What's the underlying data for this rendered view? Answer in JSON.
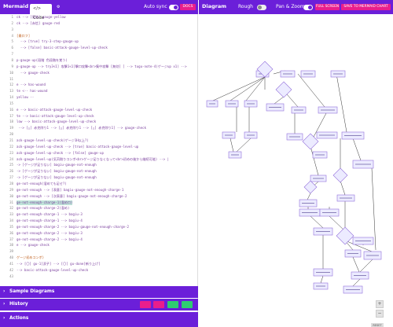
{
  "editor": {
    "title": "Mermaid",
    "tabs": [
      {
        "label": "Code",
        "icon": "code-icon"
      },
      {
        "label": "Config",
        "icon": "gear-icon"
      }
    ],
    "auto_sync_label": "Auto sync",
    "docs_label": "DOCS",
    "lines": [
      "ck --> [見地] gauge-yellow",
      "ck --> [赤信] gauge-red",
      "",
      "[最口フ]",
      "  --> [true] try-3-step-gauge-up",
      "  --> [false] basic-attack-gauge-level-up-check",
      "",
      "p-gauge-up(段階 色段階を覚う)",
      "p-gauge-up --> try3<1] 攻撃1<1]撃口攻撃<br>集中攻撃 [無効] ] --> tugu-note-4(ゲージup x1) -->",
      "  --> gauge-check",
      "",
      "e --> has-wound",
      "te <-- has-wound",
      "yellow -- ",
      "",
      "e --> basic-attack-gauge-level-up-check",
      "te --> basic-attack-gauge-level-up-check",
      "low --> basic-attack-gauge-level-up-check",
      " --> [△] 赤克除り1 --> [△] 赤克除り1 --> [△] 赤克除り1] --> gauge-check",
      "",
      "ack-gauge-level-up-check(ゲージ1H以上?)",
      "ack-gauge-level-up-check --> [true] basic-attack-gauge-level-up",
      "ack-gauge-level-up-check --> [false] gauge-up",
      "ack-gauge-level-up(気苅剛りコンボ<br>ゲージ足りなくなって<br>初めの後から継続可能) --> |",
      "-> [ゲージが足りない] bagiu-gauge-not-enough",
      "-> [ゲージが足りない] bagiu-gauge-not-enough",
      "-> [ゲージが足りない] bagiu-gauge-not-enough",
      "ge-not-enough(溜めても足せ?)",
      "ge-not-enough --> [表意] bagiu-gauge-not-enough-charge-1",
      "ge-not-enough --> [次表意] bagiu-gauge-not-enough-charge-2",
      "ge-not-enough-charge-1(溜め口)",
      "ge-not-enough-charge-2(溜め)",
      "ge-not-enough-charge-1 --> bagiu-3",
      "ge-not-enough-charge-1 --> bagiu-4",
      "ge-not-enough-charge-2 --> bagiu-gauge-not-enough-charge-2",
      "ge-not-enough-charge-2 --> bagiu-3",
      "ge-not-enough-charge-2 --> bagiu-4",
      "e --> gauge-check",
      "",
      "ゲージ初めコンボ)",
      "--> [〇] gu-1[涙子] --> [〇] gu-done[斬り上げ]",
      "--> basic-attack-gauge-level-up-check",
      ""
    ],
    "line_numbers": [
      1,
      2,
      3,
      4,
      5,
      6,
      7,
      8,
      9,
      10,
      11,
      12,
      13,
      14,
      15,
      16,
      17,
      18,
      19,
      20,
      21,
      22,
      23,
      24,
      25,
      26,
      27,
      28,
      29,
      30,
      31,
      32,
      33,
      34,
      35,
      36,
      37,
      38,
      39,
      40,
      41,
      42,
      43
    ]
  },
  "sections": {
    "samples": "Sample Diagrams",
    "history": "History",
    "actions": "Actions"
  },
  "history_buttons": [
    {
      "icon": "upload-icon",
      "color": "#e91e8c"
    },
    {
      "icon": "triangle-icon",
      "color": "#e91e8c"
    },
    {
      "icon": "save-icon",
      "color": "#2ecc71"
    },
    {
      "icon": "restore-icon",
      "color": "#2ecc71"
    }
  ],
  "diagram": {
    "title": "Diagram",
    "rough_label": "Rough",
    "pan_zoom_label": "Pan & Zoom",
    "fullscreen_label": "FULL SCREEN",
    "save_label": "SAVE TO MERMAID CHART",
    "reset_label": "RESET",
    "node_fill": "#ecebff",
    "node_stroke": "#9370db"
  },
  "colors": {
    "accent": "#6b1fd9",
    "pink": "#e91e8c",
    "green": "#2ecc71"
  }
}
